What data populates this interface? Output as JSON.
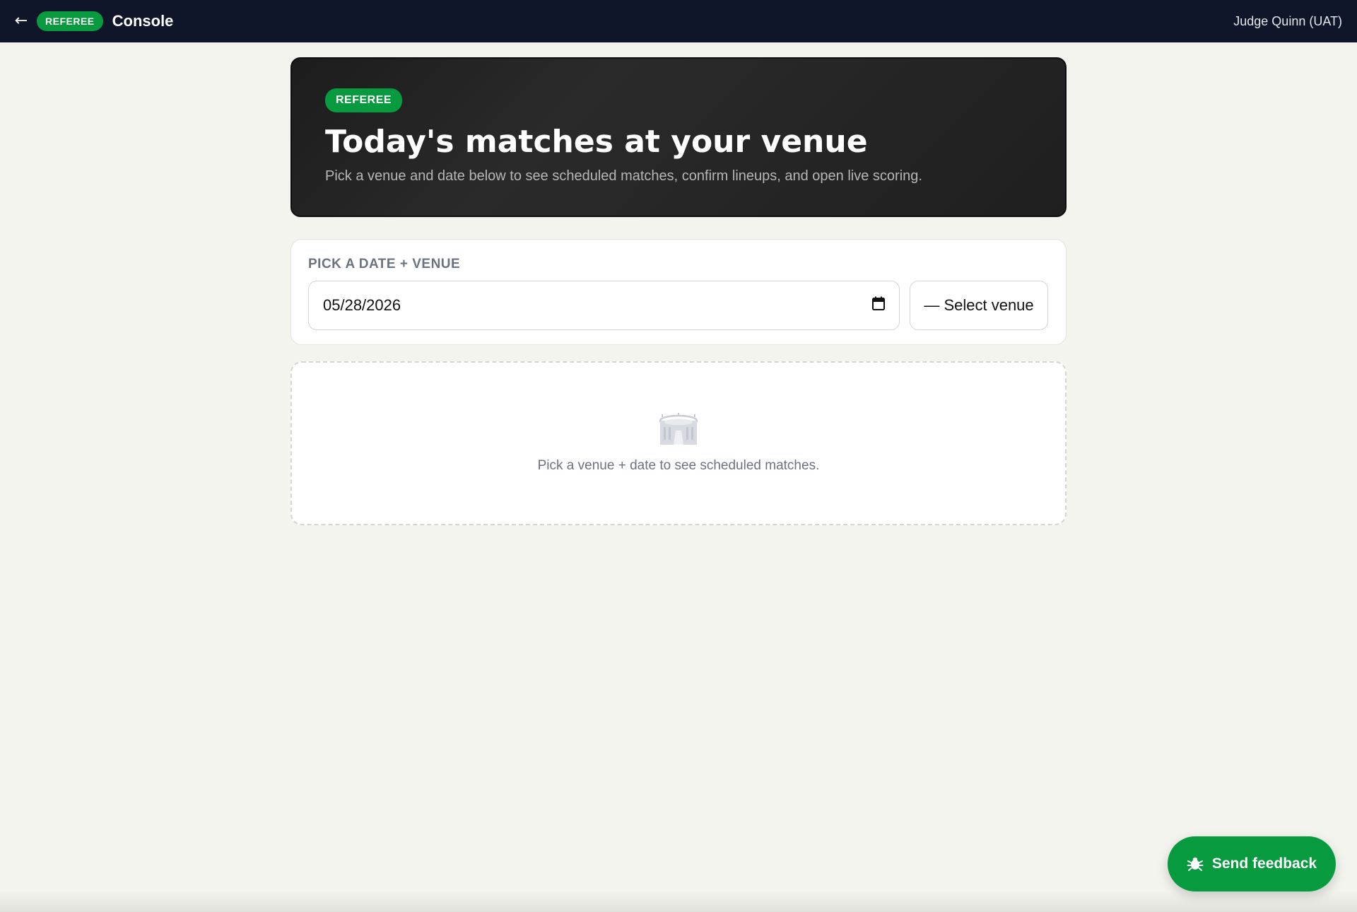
{
  "topbar": {
    "back_icon": "←",
    "role_badge": "REFEREE",
    "title": "Console",
    "user": "Judge Quinn (UAT)"
  },
  "hero": {
    "badge": "REFEREE",
    "title": "Today's matches at your venue",
    "subtitle": "Pick a venue and date below to see scheduled matches, confirm lineups, and open live scoring."
  },
  "picker": {
    "label": "PICK A DATE + VENUE",
    "date_value": "05/28/2026",
    "venue_value": "— Select venue"
  },
  "empty_state": {
    "icon": "stadium-icon",
    "message": "Pick a venue + date to see scheduled matches."
  },
  "feedback": {
    "label": "Send feedback",
    "icon": "bug-icon"
  },
  "colors": {
    "accent": "#079a3e",
    "nav_bg": "#0f1629",
    "page_bg": "#f3f4ee"
  }
}
